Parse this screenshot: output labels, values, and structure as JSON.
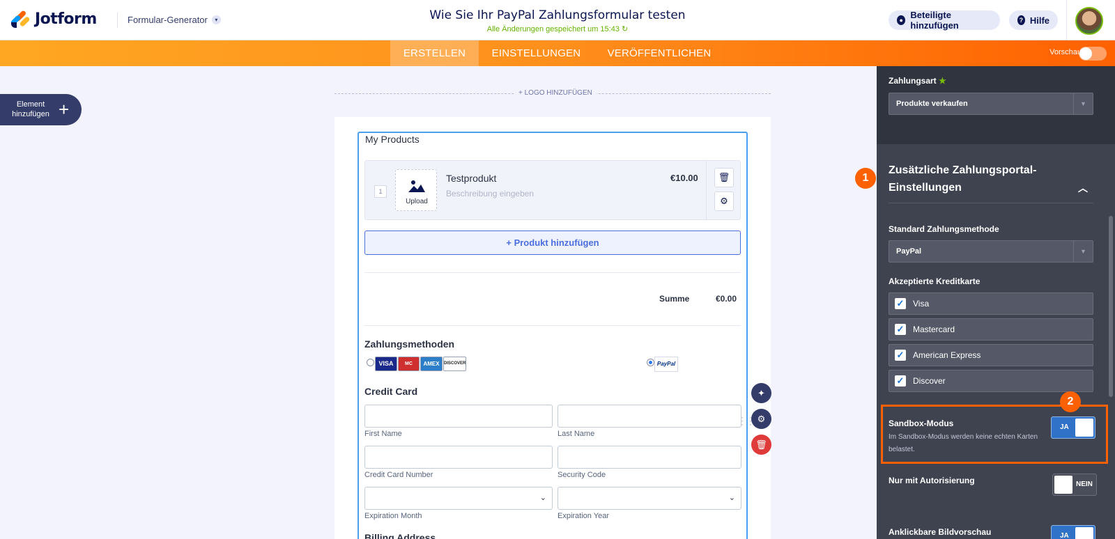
{
  "header": {
    "logo_text": "Jotform",
    "builder_menu": "Formular-Generator",
    "form_title": "Wie Sie Ihr PayPal Zahlungsformular testen",
    "save_status": "Alle Änderungen gespeichert um 15:43",
    "add_participants": "Beteiligte hinzufügen",
    "help": "Hilfe"
  },
  "nav": {
    "tabs": [
      "ERSTELLEN",
      "EINSTELLUNGEN",
      "VERÖFFENTLICHEN"
    ],
    "active_tab": "ERSTELLEN",
    "preview_label": "Vorschau"
  },
  "add_element": {
    "label": "Element hinzufügen"
  },
  "canvas": {
    "logo_add": "+ LOGO HINZUFÜGEN",
    "products_label": "My Products",
    "product": {
      "qty": "1",
      "upload": "Upload",
      "name": "Testprodukt",
      "desc_placeholder": "Beschreibung eingeben",
      "price": "€10.00"
    },
    "add_product": "+ Produkt hinzufügen",
    "sum_label": "Summe",
    "sum_value": "€0.00",
    "payment_methods": "Zahlungsmethoden",
    "card_logos": [
      "VISA",
      "MC",
      "AMEX",
      "DISCOVER"
    ],
    "paypal_label": "PayPal",
    "credit_card_title": "Credit Card",
    "fields": {
      "first_name": "First Name",
      "last_name": "Last Name",
      "cc_number": "Credit Card Number",
      "security_code": "Security Code",
      "exp_month": "Expiration Month",
      "exp_year": "Expiration Year"
    },
    "billing_address": "Billing Address"
  },
  "panel": {
    "payment_type_label": "Zahlungsart",
    "payment_type_value": "Produkte verkaufen",
    "section_heading": "Zusätzliche Zahlungsportal-Einstellungen",
    "default_method_label": "Standard Zahlungsmethode",
    "default_method_value": "PayPal",
    "accepted_cards_label": "Akzeptierte Kreditkarte",
    "cards": [
      "Visa",
      "Mastercard",
      "American Express",
      "Discover"
    ],
    "sandbox_label": "Sandbox-Modus",
    "sandbox_desc": "Im Sandbox-Modus werden keine echten Karten belastet.",
    "sandbox_state": "JA",
    "auth_only_label": "Nur mit Autorisierung",
    "auth_only_state": "NEIN",
    "clickable_preview_label": "Anklickbare Bildvorschau",
    "clickable_preview_state": "JA"
  },
  "annotations": {
    "badge_1": "1",
    "badge_2": "2"
  },
  "colors": {
    "accent_orange": "#ff6100",
    "brand_navy": "#0a1551",
    "panel_bg": "#3f4350",
    "field_highlight": "#4c9ff0"
  }
}
